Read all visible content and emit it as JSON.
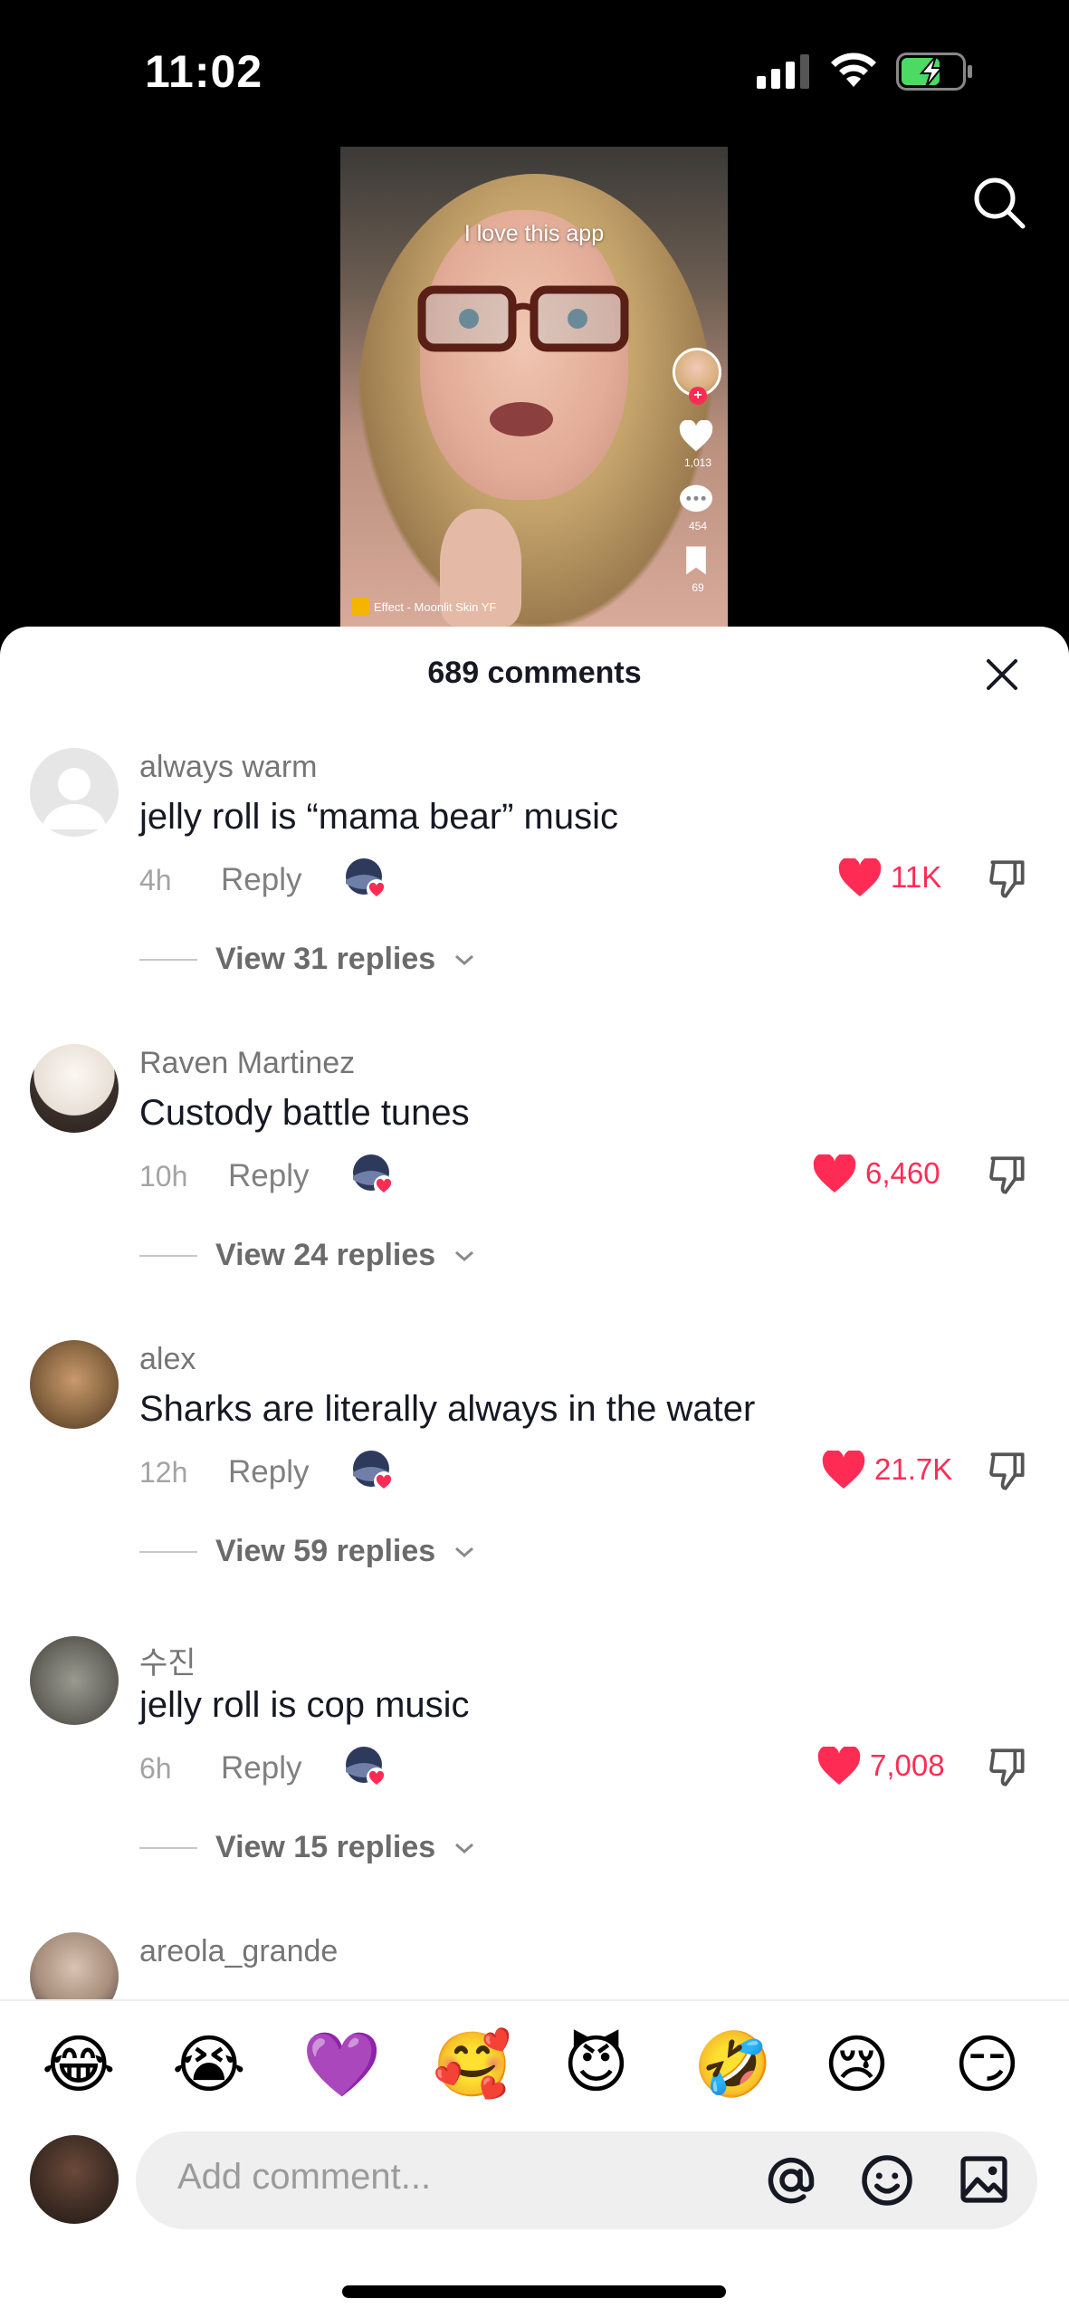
{
  "status_bar": {
    "time": "11:02"
  },
  "video": {
    "caption": "I love this app",
    "likes": "1,013",
    "comments": "454",
    "saves": "69",
    "effect": "Effect - Moonlit Skin YF"
  },
  "sheet": {
    "title": "689 comments"
  },
  "comments": [
    {
      "user": "always warm",
      "text": "jelly roll is “mama bear” music",
      "time": "4h",
      "reply": "Reply",
      "likes": "11K",
      "replies": "View 31 replies"
    },
    {
      "user": "Raven Martinez",
      "text": "Custody battle tunes",
      "time": "10h",
      "reply": "Reply",
      "likes": "6,460",
      "replies": "View 24 replies"
    },
    {
      "user": "alex",
      "text": "Sharks are literally always in the water",
      "time": "12h",
      "reply": "Reply",
      "likes": "21.7K",
      "replies": "View 59 replies"
    },
    {
      "user": "수진",
      "text": "jelly roll is cop music",
      "time": "6h",
      "reply": "Reply",
      "likes": "7,008",
      "replies": "View 15 replies"
    },
    {
      "user": "areola_grande"
    }
  ],
  "emoji_bar": [
    "😂",
    "😭",
    "💜",
    "🥰",
    "😈",
    "🤣",
    "😢",
    "😏"
  ],
  "input": {
    "placeholder": "Add comment..."
  },
  "colors": {
    "accent": "#fe2c55",
    "sheet_bg": "#ffffff",
    "text": "#161823"
  },
  "icons": [
    "search-icon",
    "close-icon",
    "heart-icon",
    "dislike-icon",
    "at-icon",
    "emoji-icon",
    "image-icon",
    "chevron-down-icon"
  ]
}
